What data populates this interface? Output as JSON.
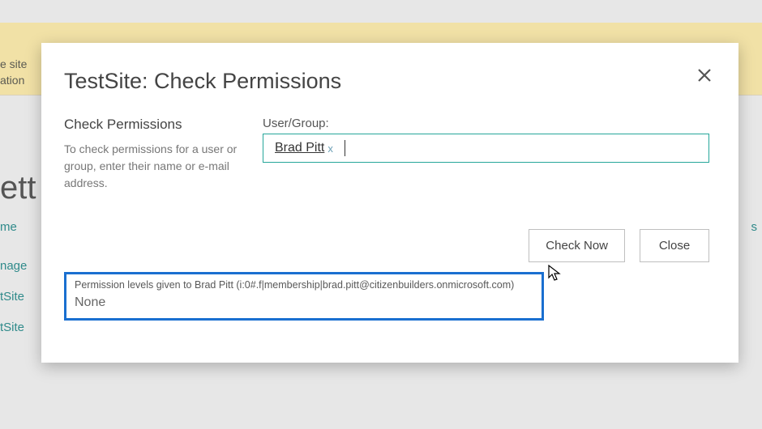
{
  "background": {
    "bar_text_1": "e site",
    "bar_text_2": "ation",
    "heading_fragment": "ett",
    "link_me": "me",
    "link_nage": "nage",
    "link_tsite1": "tSite",
    "link_tsite2": "tSite",
    "right_link_fragment": "s"
  },
  "dialog": {
    "title": "TestSite: Check Permissions",
    "section_heading": "Check Permissions",
    "section_description": "To check permissions for a user or group, enter their name or e-mail address.",
    "field_label": "User/Group:",
    "picked_user": "Brad Pitt",
    "remove_glyph": "x",
    "check_now_label": "Check Now",
    "close_label": "Close",
    "result_heading": "Permission levels given to Brad Pitt (i:0#.f|membership|brad.pitt@citizenbuilders.onmicrosoft.com)",
    "result_value": "None"
  }
}
